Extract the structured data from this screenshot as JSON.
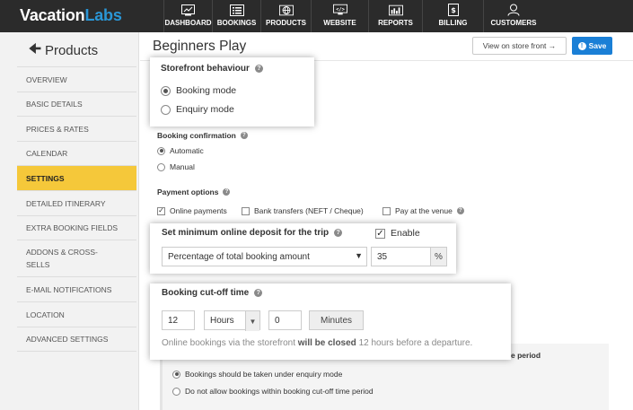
{
  "brand": {
    "part1": "Vacation",
    "part2": "Labs"
  },
  "nav": [
    {
      "label": "DASHBOARD",
      "icon": "dashboard-icon"
    },
    {
      "label": "BOOKINGS",
      "icon": "bookings-icon"
    },
    {
      "label": "PRODUCTS",
      "icon": "globe-icon"
    },
    {
      "label": "WEBSITE",
      "icon": "code-icon"
    },
    {
      "label": "REPORTS",
      "icon": "reports-icon"
    },
    {
      "label": "BILLING",
      "icon": "billing-icon"
    },
    {
      "label": "CUSTOMERS",
      "icon": "user-icon"
    }
  ],
  "sidebar": {
    "title": "Products",
    "items": [
      {
        "label": "OVERVIEW"
      },
      {
        "label": "BASIC DETAILS"
      },
      {
        "label": "PRICES & RATES"
      },
      {
        "label": "CALENDAR"
      },
      {
        "label": "SETTINGS"
      },
      {
        "label": "DETAILED ITINERARY"
      },
      {
        "label": "EXTRA BOOKING FIELDS"
      },
      {
        "label": "ADDONS & CROSS-",
        "label2": "SELLS"
      },
      {
        "label": "E-MAIL NOTIFICATIONS"
      },
      {
        "label": "LOCATION"
      },
      {
        "label": "ADVANCED SETTINGS"
      }
    ]
  },
  "header": {
    "title": "Beginners Play",
    "store_button": "View on store front →",
    "save_button": "Save"
  },
  "storefront": {
    "label": "Storefront behaviour",
    "options": [
      "Booking mode",
      "Enquiry mode"
    ]
  },
  "confirmation": {
    "label": "Booking confirmation",
    "options": [
      "Automatic",
      "Manual"
    ]
  },
  "payment": {
    "label": "Payment options",
    "options": [
      "Online payments",
      "Bank transfers (NEFT / Cheque)",
      "Pay at the venue"
    ]
  },
  "deposit": {
    "label": "Set minimum online deposit for the trip",
    "enable_label": "Enable",
    "type_value": "Percentage of total booking amount",
    "amount_value": "35",
    "unit": "%"
  },
  "cutoff": {
    "label": "Booking cut-off time",
    "hours_value": "12",
    "hours_unit": "Hours",
    "minutes_value": "0",
    "minutes_unit": "Minutes",
    "note_prefix": "Online bookings via the storefront ",
    "note_bold": "will be closed",
    "note_suffix": " 12 hours before a departure."
  },
  "cutoff_period": {
    "header_tail": "e period",
    "options": [
      "Bookings should be taken under enquiry mode",
      "Do not allow bookings within booking cut-off time period"
    ]
  }
}
